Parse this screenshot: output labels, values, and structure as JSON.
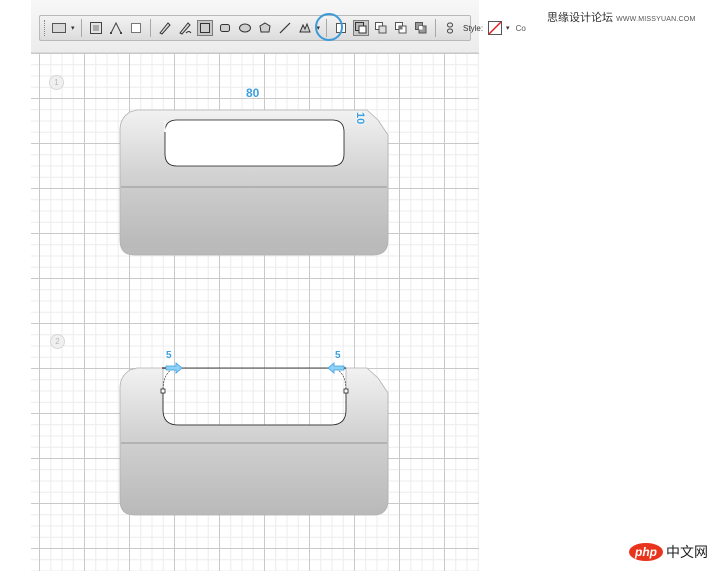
{
  "watermark": {
    "cn": "思缘设计论坛",
    "site": "WWW.MISSYUAN.COM"
  },
  "toolbar": {
    "style_label": "Style:",
    "color_label": "Co"
  },
  "steps": [
    {
      "number": "1"
    },
    {
      "number": "2"
    }
  ],
  "step1": {
    "width_label": "80",
    "height_label": "10"
  },
  "step2": {
    "left_label": "5",
    "right_label": "5"
  },
  "logo": {
    "badge": "php",
    "text": "中文网"
  },
  "colors": {
    "accent": "#3a9fe0",
    "grid_major": "#c9c9c9",
    "grid_minor": "#ececec"
  }
}
